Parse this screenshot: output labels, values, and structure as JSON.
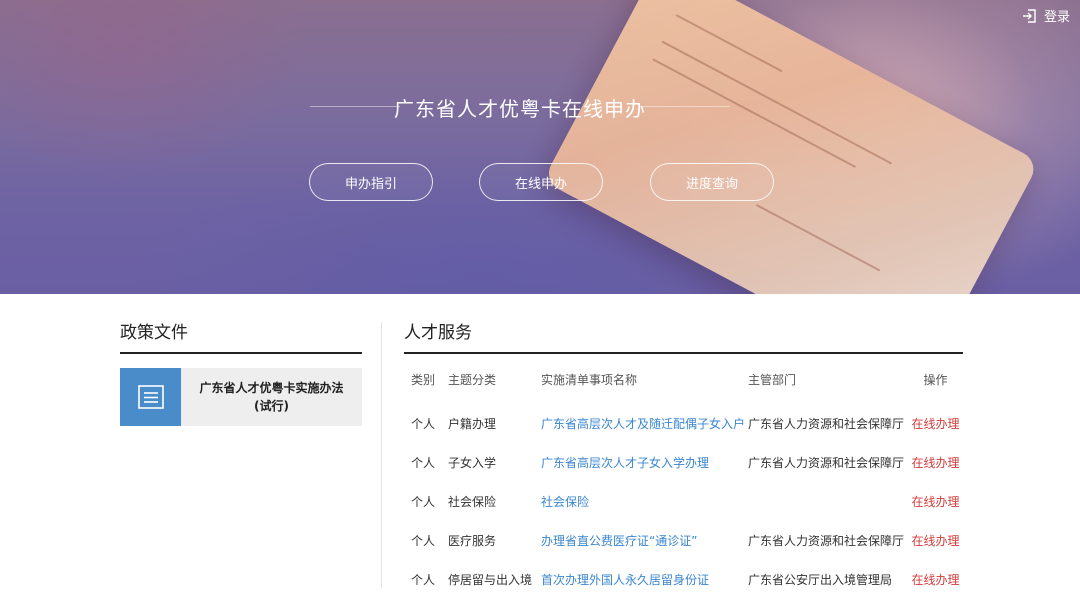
{
  "header": {
    "login_label": "登录"
  },
  "hero": {
    "title": "广东省人才优粤卡在线申办",
    "buttons": [
      "申办指引",
      "在线申办",
      "进度查询"
    ]
  },
  "policy": {
    "title": "政策文件",
    "doc_line1": "广东省人才优粤卡实施办法",
    "doc_line2": "(试行)"
  },
  "services": {
    "title": "人才服务",
    "columns": [
      "类别",
      "主题分类",
      "实施清单事项名称",
      "主管部门",
      "操作"
    ],
    "rows": [
      {
        "category": "个人",
        "topic": "户籍办理",
        "item": "广东省高层次人才及随迁配偶子女入户",
        "dept": "广东省人力资源和社会保障厅",
        "action": "在线办理"
      },
      {
        "category": "个人",
        "topic": "子女入学",
        "item": "广东省高层次人才子女入学办理",
        "dept": "广东省人力资源和社会保障厅",
        "action": "在线办理"
      },
      {
        "category": "个人",
        "topic": "社会保险",
        "item": "社会保险",
        "dept": "",
        "action": "在线办理"
      },
      {
        "category": "个人",
        "topic": "医疗服务",
        "item": "办理省直公费医疗证“通诊证”",
        "dept": "广东省人力资源和社会保障厅",
        "action": "在线办理"
      },
      {
        "category": "个人",
        "topic": "停居留与出入境",
        "item": "首次办理外国人永久居留身份证",
        "dept": "广东省公安厅出入境管理局",
        "action": "在线办理"
      }
    ]
  },
  "colors": {
    "accent_blue": "#3a86d1",
    "action_red": "#d43b3b",
    "doc_icon_bg": "#4a8cc9"
  },
  "icons": {
    "login": "sign-in-icon",
    "document": "document-list-icon"
  }
}
